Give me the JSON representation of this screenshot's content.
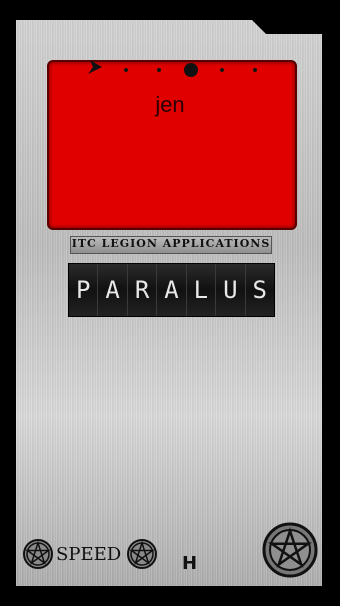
{
  "screen": {
    "reading": "jen",
    "background": "#e00000"
  },
  "brand": {
    "text": "ITC LEGION APPLICATIONS"
  },
  "title": {
    "letters": [
      "P",
      "A",
      "R",
      "A",
      "L",
      "U",
      "S"
    ]
  },
  "controls": {
    "speed_label": "SPEED",
    "mode_label": "H"
  },
  "icons": {
    "arrow": "arrow-pointer-icon",
    "pentacle": "pentacle-icon"
  }
}
